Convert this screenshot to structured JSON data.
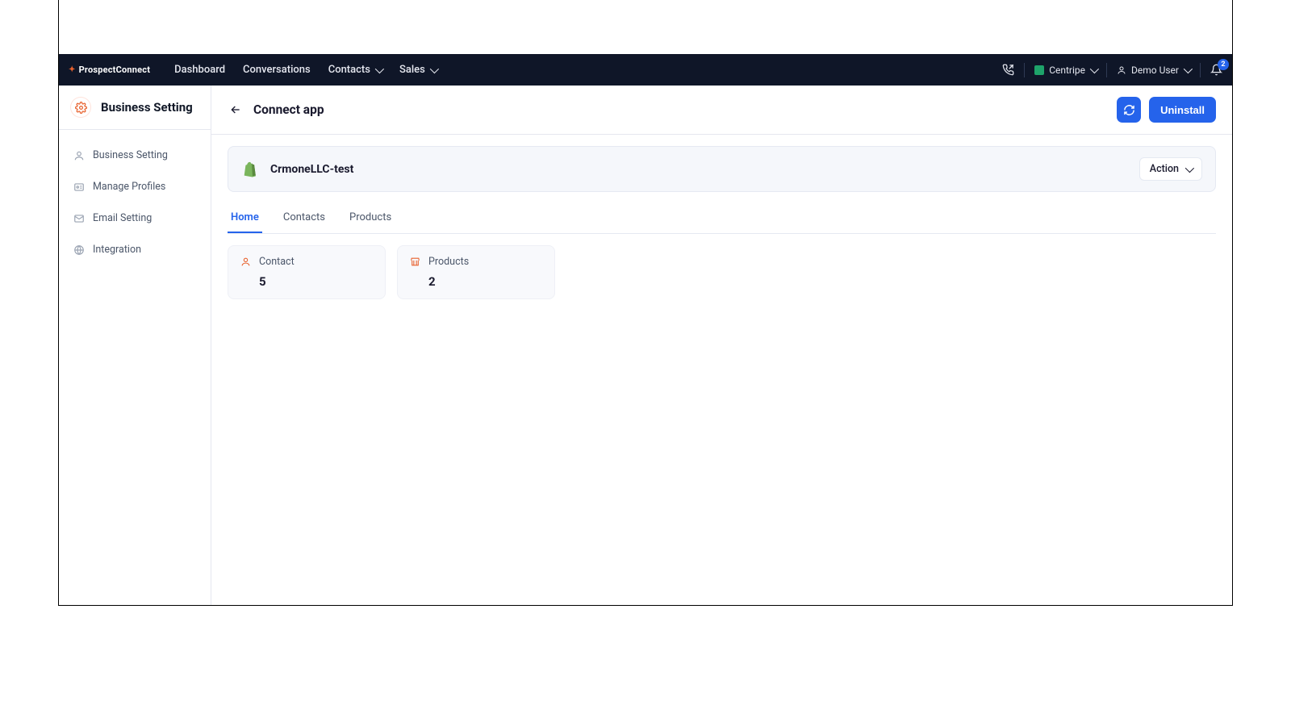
{
  "brand": {
    "name": "ProspectConnect"
  },
  "nav": {
    "links": [
      {
        "label": "Dashboard",
        "dropdown": false
      },
      {
        "label": "Conversations",
        "dropdown": false
      },
      {
        "label": "Contacts",
        "dropdown": true
      },
      {
        "label": "Sales",
        "dropdown": true
      }
    ],
    "workspace": "Centripe",
    "user": "Demo User",
    "notif_count": "2"
  },
  "sidebar": {
    "title": "Business Setting",
    "items": [
      {
        "label": "Business Setting"
      },
      {
        "label": "Manage Profiles"
      },
      {
        "label": "Email Setting"
      },
      {
        "label": "Integration"
      }
    ]
  },
  "page": {
    "title": "Connect app",
    "refresh_label": "",
    "uninstall_label": "Uninstall"
  },
  "app": {
    "name": "CrmoneLLC-test",
    "action_label": "Action"
  },
  "tabs": [
    {
      "label": "Home",
      "active": true
    },
    {
      "label": "Contacts",
      "active": false
    },
    {
      "label": "Products",
      "active": false
    }
  ],
  "stats": [
    {
      "label": "Contact",
      "value": "5",
      "icon": "user"
    },
    {
      "label": "Products",
      "value": "2",
      "icon": "shop"
    }
  ]
}
